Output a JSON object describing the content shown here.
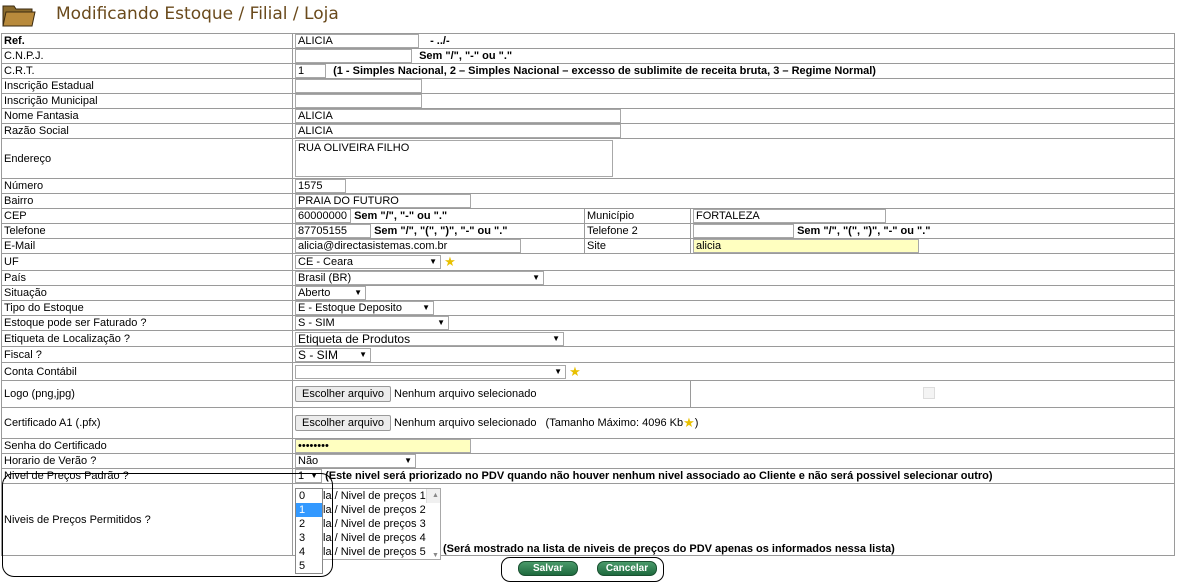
{
  "title": "Modificando Estoque / Filial / Loja",
  "ref": {
    "label": "Ref.",
    "value": "ALICIA",
    "suffix": "- ../-"
  },
  "cnpj": {
    "label": "C.N.P.J.",
    "value": "",
    "hint": "Sem \"/\", \"-\" ou \".\""
  },
  "crt": {
    "label": "C.R.T.",
    "value": "1",
    "hint": "(1 - Simples Nacional, 2 – Simples Nacional – excesso de sublimite de receita bruta, 3 – Regime Normal)"
  },
  "insc_estadual": {
    "label": "Inscrição Estadual",
    "value": ""
  },
  "insc_municipal": {
    "label": "Inscrição Municipal",
    "value": ""
  },
  "nome_fantasia": {
    "label": "Nome Fantasia",
    "value": "ALICIA"
  },
  "razao_social": {
    "label": "Razão Social",
    "value": "ALICIA"
  },
  "endereco": {
    "label": "Endereço",
    "value": "RUA OLIVEIRA FILHO"
  },
  "numero": {
    "label": "Número",
    "value": "1575"
  },
  "bairro": {
    "label": "Bairro",
    "value": "PRAIA DO FUTURO"
  },
  "cep": {
    "label": "CEP",
    "value": "60000000",
    "hint": "Sem \"/\", \"-\" ou \".\""
  },
  "municipio": {
    "label": "Município",
    "value": "FORTALEZA"
  },
  "telefone": {
    "label": "Telefone",
    "value": "87705155",
    "hint": "Sem \"/\", \"(\", \")\", \"-\" ou \".\""
  },
  "telefone2": {
    "label": "Telefone 2",
    "value": "",
    "hint": "Sem \"/\", \"(\", \")\", \"-\" ou \".\""
  },
  "email": {
    "label": "E-Mail",
    "value": "alicia@directasistemas.com.br"
  },
  "site": {
    "label": "Site",
    "value": "alicia"
  },
  "uf": {
    "label": "UF",
    "value": "CE - Ceara"
  },
  "pais": {
    "label": "País",
    "value": "Brasil (BR)"
  },
  "situacao": {
    "label": "Situação",
    "value": "Aberto"
  },
  "tipo_estoque": {
    "label": "Tipo do Estoque",
    "value": "E - Estoque Deposito"
  },
  "estoque_faturado": {
    "label": "Estoque pode ser Faturado ?",
    "value": "S - SIM"
  },
  "etiqueta": {
    "label": "Etiqueta de Localização ?",
    "value": "Etiqueta de Produtos"
  },
  "fiscal": {
    "label": "Fiscal ?",
    "value": "S - SIM"
  },
  "conta_contabil": {
    "label": "Conta Contábil",
    "value": ""
  },
  "logo": {
    "label": "Logo (png,jpg)",
    "button": "Escolher arquivo",
    "status": "Nenhum arquivo selecionado"
  },
  "certificado": {
    "label": "Certificado A1 (.pfx)",
    "button": "Escolher arquivo",
    "status": "Nenhum arquivo selecionado",
    "max": "(Tamanho Máximo: 4096 Kb",
    "max_close": ")"
  },
  "senha": {
    "label": "Senha do Certificado",
    "value": "••••••••"
  },
  "horario_verao": {
    "label": "Horario de Verão ?",
    "value": "Não"
  },
  "nivel_padrao": {
    "label": "Nivel de Preços Padrão ?",
    "value": "1",
    "hint": "(Este nivel será priorizado no PDV quando não houver nenhum nivel associado ao Cliente e não será possivel selecionar outro)",
    "options": [
      "0",
      "1",
      "2",
      "3",
      "4",
      "5"
    ],
    "highlighted": "1"
  },
  "niveis_permitidos": {
    "label": "Niveis de Preços Permitidos ?",
    "items": [
      "la / Nivel de preços 1",
      "la / Nivel de preços 2",
      "la / Nivel de preços 3",
      "la / Nivel de preços 4",
      "la / Nivel de preços 5"
    ],
    "hint_left": "(Será mostrado na lista de",
    "hint_right": "niveis de preços do PDV apenas os informados nessa lista)"
  },
  "buttons": {
    "save": "Salvar",
    "cancel": "Cancelar"
  },
  "colors": {
    "title": "#6a4a1c",
    "button": "#1e6a3e",
    "highlight": "#3399ff",
    "yellow_field": "#ffffc0"
  }
}
